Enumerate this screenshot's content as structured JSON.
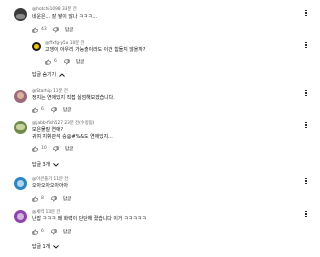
{
  "comments": [
    {
      "handle": "@hotchi1098",
      "time": "33분 전",
      "text": "네운은... 잘 쌓이 않나 ㅋㅋㅋ...",
      "likes": "43",
      "reply_label": "답글"
    },
    {
      "handle": "@ffxfg-y5x",
      "time": "10분 전",
      "text": "고쟁이 아우리 가능출이라도 이건 힘들지 않을까?",
      "likes": "6",
      "reply_label": "답글"
    },
    {
      "handle": "@Starhip",
      "time": "11분 전",
      "text": "정지는 연애있지 직접 싫엄해보겠습니다.",
      "likes": "6",
      "reply_label": "답글"
    },
    {
      "handle": "@jabb-fish527",
      "time": "23분 전(수정됨)",
      "text_lines": [
        "모은물질 연애?",
        "귀여 지휘관석 승@#%&도 연애있지..."
      ],
      "likes": "10",
      "reply_label": "답글"
    },
    {
      "handle": "@아큰플기",
      "time": "11분 전",
      "text": "오아오아오아아아",
      "likes": "8",
      "reply_label": "답글"
    },
    {
      "handle": "@세력",
      "time": "13분 전",
      "text": "난잡 ㅋㅋㅋ 왜 화력이 단단해 졌습니다 이거 ㅋㅋㅋㅋㅋ",
      "likes": "6",
      "reply_label": "답글"
    }
  ],
  "toggles": {
    "hide_replies": "답글 숨기기",
    "replies_3": "답글 3개",
    "replies_1": "답글 1개"
  },
  "icons": {
    "like": "thumbs-up-icon",
    "dislike": "thumbs-down-icon",
    "more": "more-vert-icon",
    "chevron_up": "chevron-up-icon",
    "chevron_down": "chevron-down-icon"
  },
  "colors": {
    "text": "#0f0f0f",
    "secondary": "#606060",
    "avatar1": "#3a3a3a",
    "avatar2": "#1a1a1a",
    "avatar3": "#9a6a78",
    "avatar4": "#6f8a4a",
    "avatar5": "#2e86c1",
    "avatar6": "#8e44ad"
  }
}
